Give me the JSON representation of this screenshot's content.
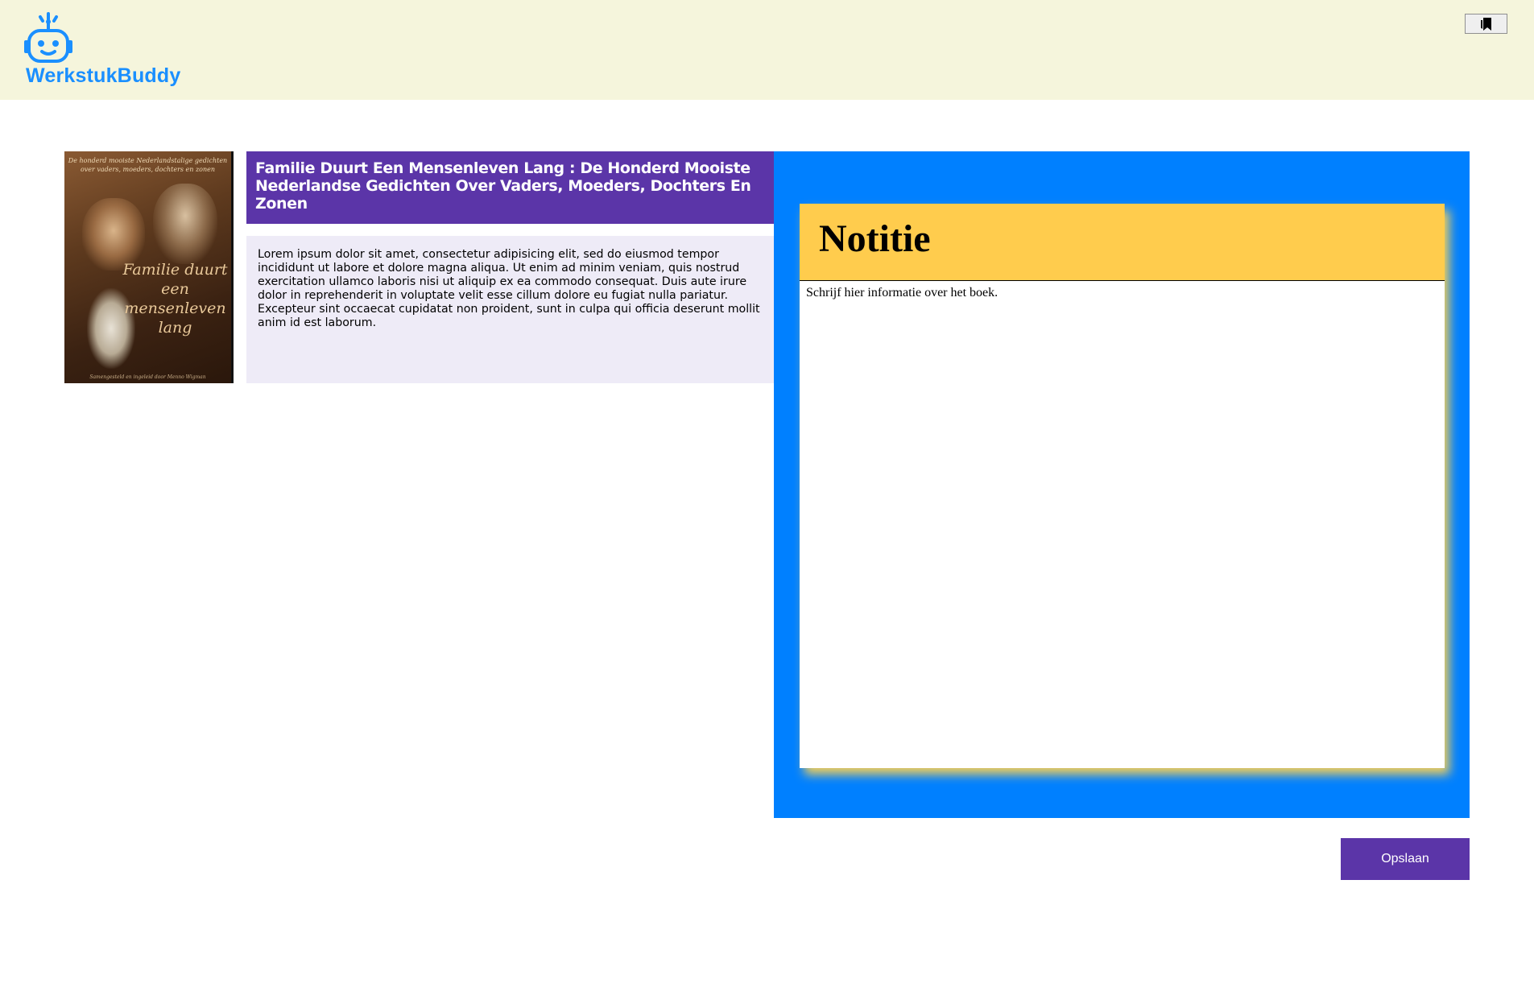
{
  "header": {
    "logo_icon": "robot-icon",
    "logo_text": "WerkstukBuddy",
    "bookmark_icon": "bookmark-icon"
  },
  "book": {
    "cover": {
      "tagline": "De honderd mooiste Nederlandstalige gedichten over vaders, moeders, dochters en zonen",
      "title": "Familie duurt een mensenleven lang",
      "credit": "Samengesteld en ingeleid door Menno Wigman"
    },
    "title": "Familie Duurt Een Mensenleven Lang : De Honderd Mooiste Nederlandse Gedichten Over Vaders, Moeders, Dochters En Zonen",
    "description": "Lorem ipsum dolor sit amet, consectetur adipisicing elit, sed do eiusmod tempor incididunt ut labore et dolore magna aliqua. Ut enim ad minim veniam, quis nostrud exercitation ullamco laboris nisi ut aliquip ex ea commodo consequat. Duis aute irure dolor in reprehenderit in voluptate velit esse cillum dolore eu fugiat nulla pariatur. Excepteur sint occaecat cupidatat non proident, sunt in culpa qui officia deserunt mollit anim id est laborum."
  },
  "note": {
    "title": "Notitie",
    "placeholder": "Schrijf hier informatie over het boek.",
    "value": ""
  },
  "actions": {
    "save_label": "Opslaan"
  },
  "colors": {
    "header_bg": "#f5f5dc",
    "brand": "#1a8fff",
    "purple": "#5b35a8",
    "panel_blue": "#0080ff",
    "note_yellow": "#ffcc4d",
    "description_bg": "#eeebf7"
  }
}
